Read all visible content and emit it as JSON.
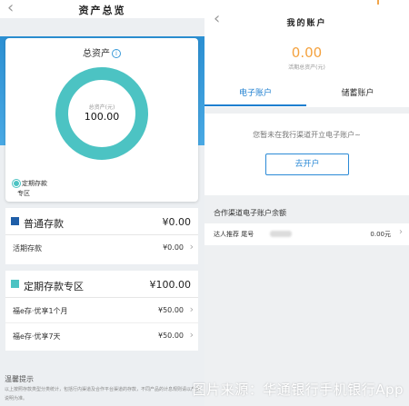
{
  "left": {
    "header": {
      "back_icon": "chevron-left-icon",
      "title": "资产总览"
    },
    "card": {
      "title": "总资产",
      "info_icon": "info-icon",
      "ring_label": "总资产(元)",
      "ring_value": "100.00",
      "ring_fill_fraction": 1.0,
      "legend_label": "定期存款",
      "legend_sub": "专区"
    },
    "current": {
      "title": "普通存款",
      "amount": "¥0.00",
      "rows": [
        {
          "label": "活期存款",
          "amount": "¥0.00"
        }
      ]
    },
    "fixed": {
      "title": "定期存款专区",
      "amount": "¥100.00",
      "rows": [
        {
          "label": "福e存·优享1个月",
          "amount": "¥50.00"
        },
        {
          "label": "福e存·优享7天",
          "amount": "¥50.00"
        }
      ]
    },
    "tips": {
      "title": "温馨提示",
      "text": "以上按照存款类型分类统计，包括行内渠道及合作平台渠道的存款，不同产品的计息规则请以产品说明为准。"
    }
  },
  "right": {
    "header": {
      "back_icon": "chevron-left-icon",
      "title": "我的账户"
    },
    "amount": "0.00",
    "amount_label": "活期总资产(元)",
    "tabs": [
      "电子账户",
      "储蓄账户"
    ],
    "active_tab": 0,
    "empty_message": "您暂未在我行渠道开立电子账户~",
    "open_button": "去开户",
    "coop_title": "合作渠道电子账户余额",
    "coop_row": {
      "label": "达人推荐 尾号",
      "amount": "0.00元"
    }
  },
  "watermark": "图片来源：华通银行手机银行App",
  "colors": {
    "primary_blue": "#1e7fd0",
    "ring_teal": "#4cc3c3",
    "amount_orange": "#f4a23f",
    "current_square": "#1f5ea8",
    "fixed_square": "#4cc3c3"
  }
}
